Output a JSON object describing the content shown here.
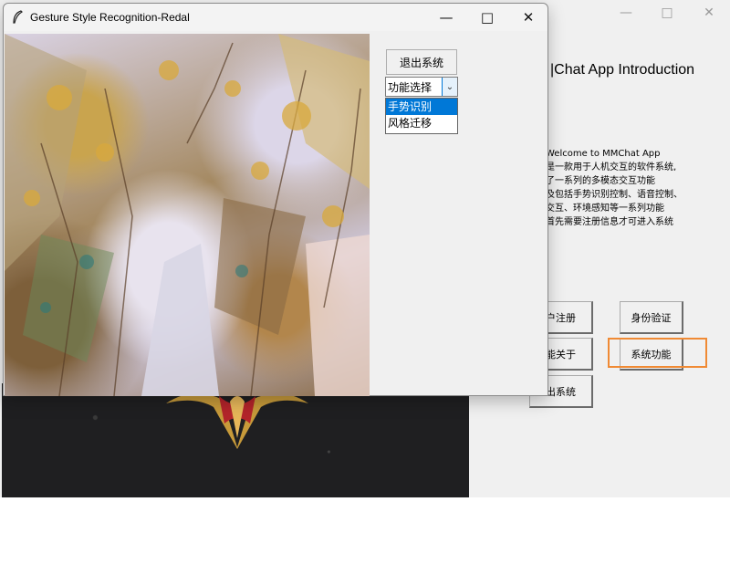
{
  "background_window": {
    "intro_title": "|Chat App Introduction",
    "intro_lines": [
      "Welcome to MMChat App",
      "是一款用于人机交互的软件系统,",
      "了一系列的多模态交互功能",
      "及包括手势识别控制、语音控制、",
      "交互、环境感知等一系列功能",
      "首先需要注册信息才可进入系统"
    ],
    "buttons": {
      "register": "户注册",
      "verify": "身份验证",
      "about": "能关于",
      "system": "系统功能",
      "exit": "出系统"
    },
    "accent_color": "#f08a34"
  },
  "gesture_window": {
    "title": "Gesture Style Recognition-Redal",
    "exit_button": "退出系统",
    "combo_value": "功能选择",
    "options": [
      "手势识别",
      "风格迁移"
    ],
    "selected_index": 0,
    "highlight_color": "#0078d7"
  }
}
